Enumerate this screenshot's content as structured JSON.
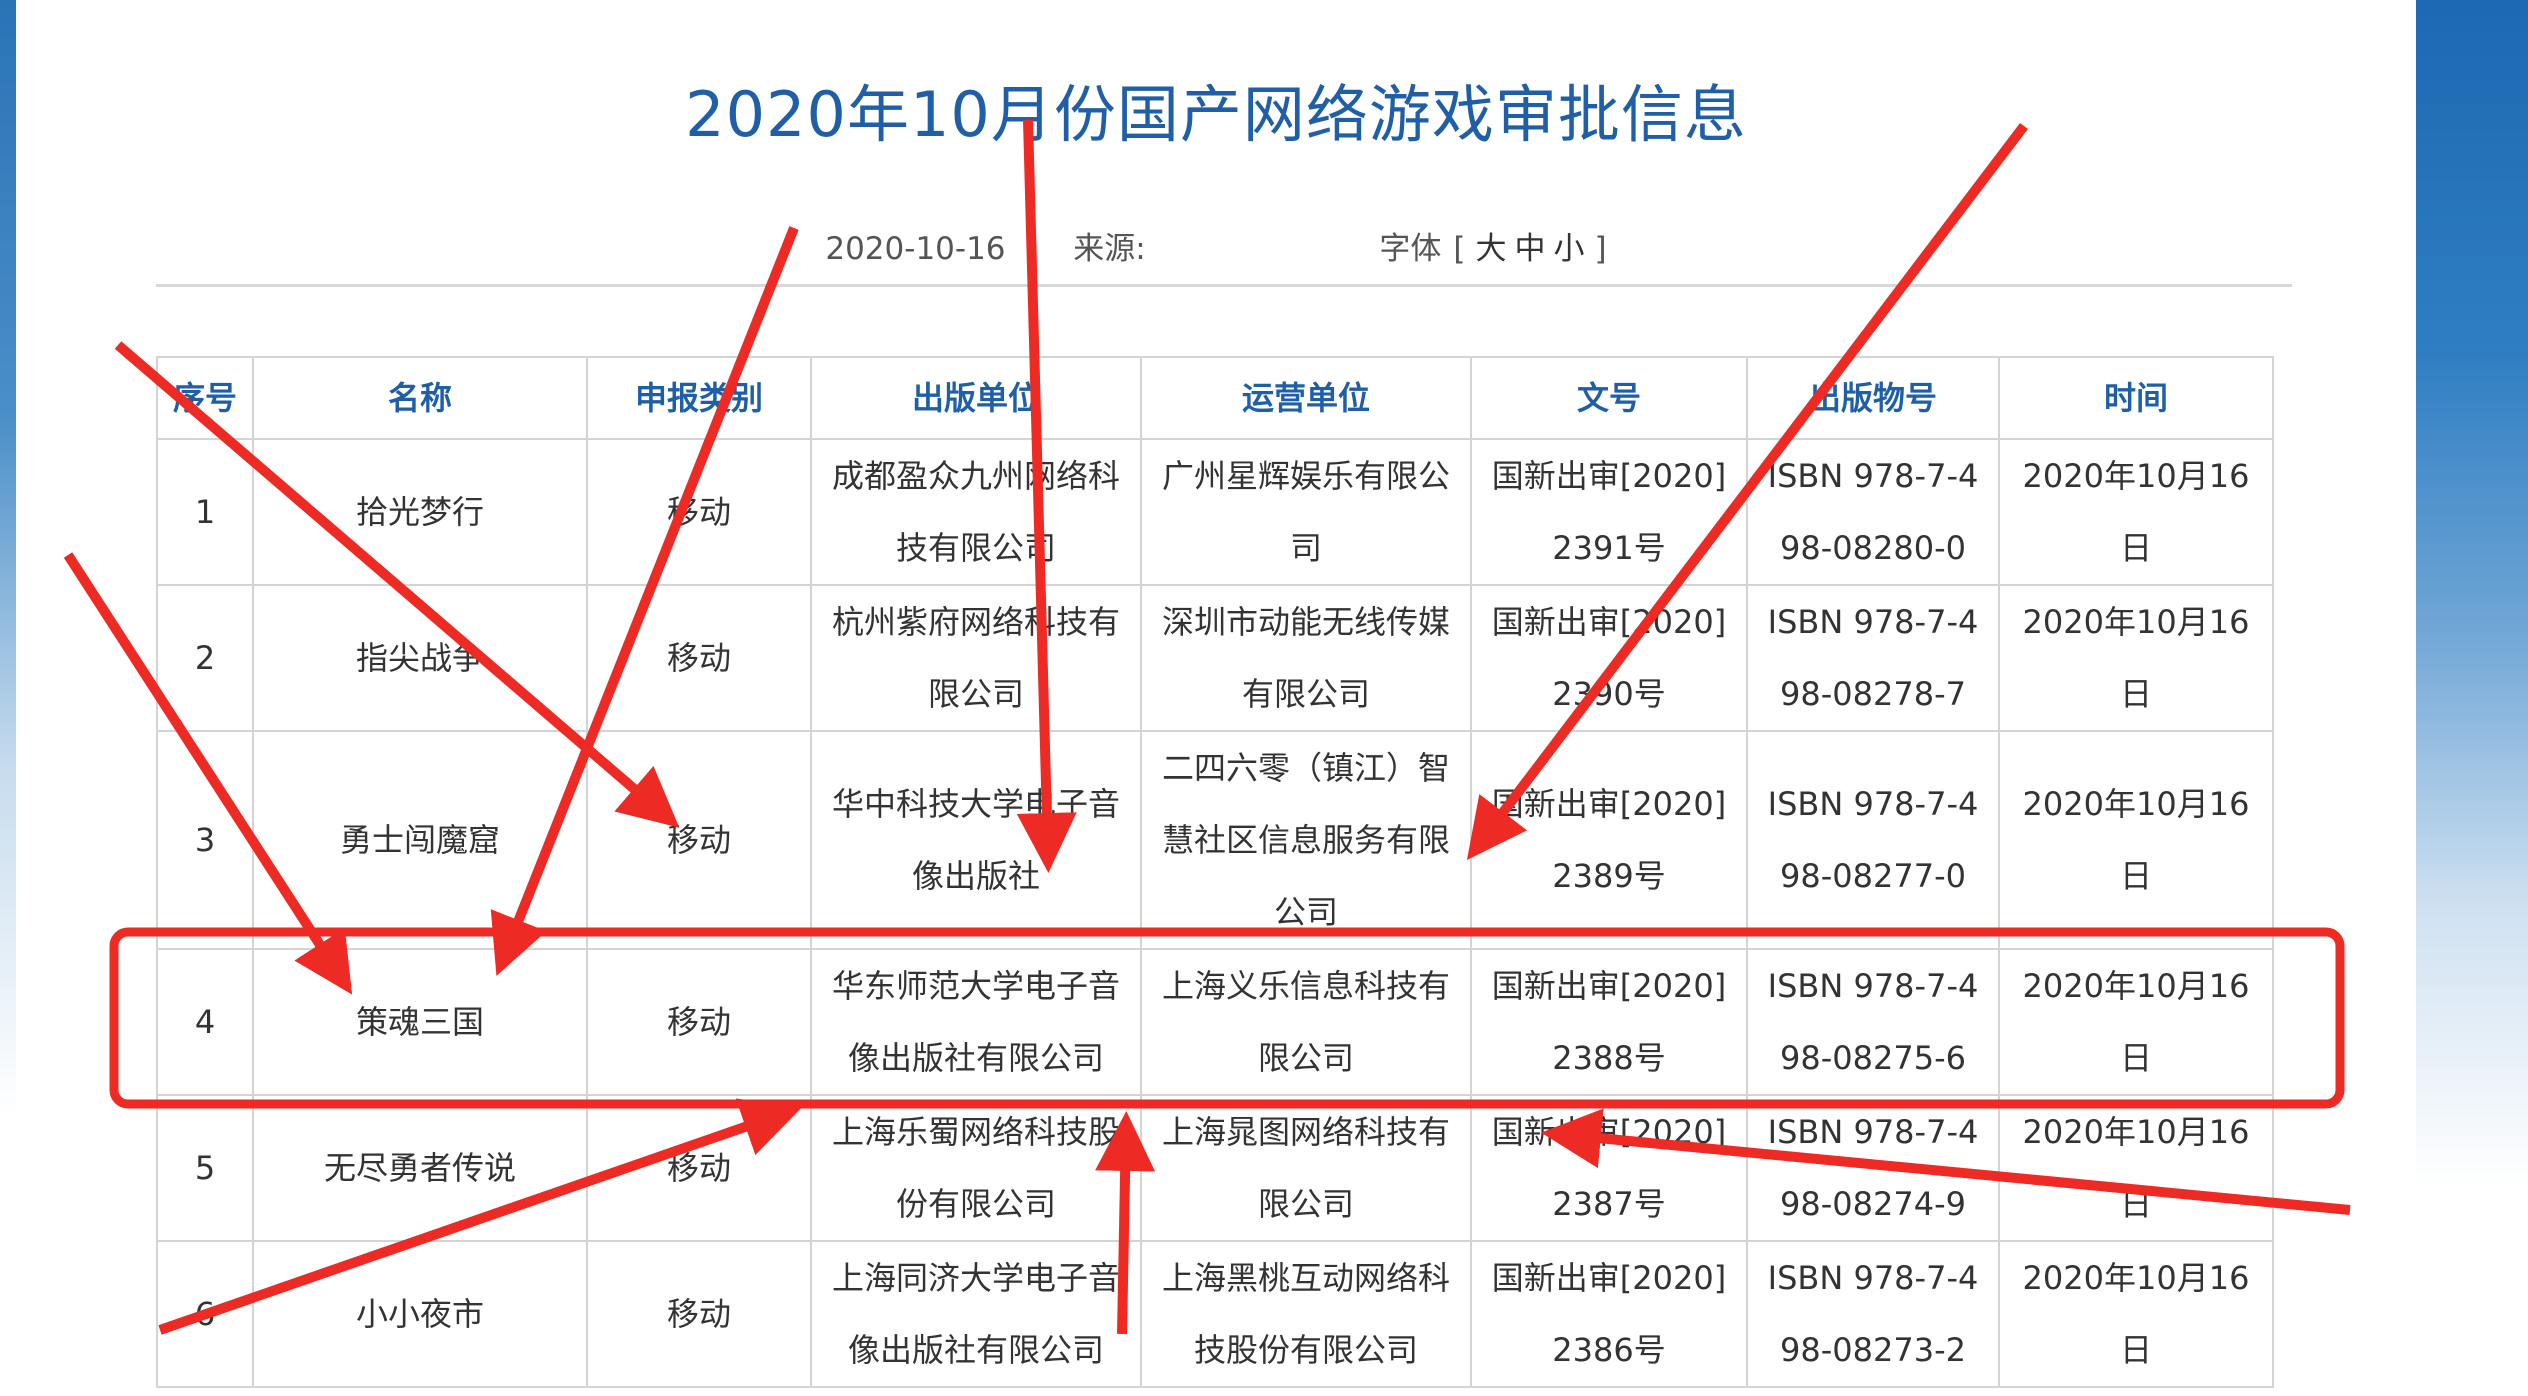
{
  "page": {
    "title": "2020年10月份国产网络游戏审批信息",
    "date": "2020-10-16",
    "source_label": "来源:",
    "font_label": "字体",
    "bracket_open": "[",
    "bracket_close": "]",
    "font_sizes": [
      "大",
      "中",
      "小"
    ]
  },
  "table": {
    "headers": [
      "序号",
      "名称",
      "申报类别",
      "出版单位",
      "运营单位",
      "文号",
      "出版物号",
      "时间"
    ],
    "rows": [
      [
        "1",
        "拾光梦行",
        "移动",
        "成都盈众九州网络科技有限公司",
        "广州星辉娱乐有限公司",
        "国新出审[2020]2391号",
        "ISBN 978-7-498-08280-0",
        "2020年10月16日"
      ],
      [
        "2",
        "指尖战争",
        "移动",
        "杭州紫府网络科技有限公司",
        "深圳市动能无线传媒有限公司",
        "国新出审[2020]2390号",
        "ISBN 978-7-498-08278-7",
        "2020年10月16日"
      ],
      [
        "3",
        "勇士闯魔窟",
        "移动",
        "华中科技大学电子音像出版社",
        "二四六零（镇江）智慧社区信息服务有限公司",
        "国新出审[2020]2389号",
        "ISBN 978-7-498-08277-0",
        "2020年10月16日"
      ],
      [
        "4",
        "策魂三国",
        "移动",
        "华东师范大学电子音像出版社有限公司",
        "上海义乐信息科技有限公司",
        "国新出审[2020]2388号",
        "ISBN 978-7-498-08275-6",
        "2020年10月16日"
      ],
      [
        "5",
        "无尽勇者传说",
        "移动",
        "上海乐蜀网络科技股份有限公司",
        "上海晁图网络科技有限公司",
        "国新出审[2020]2387号",
        "ISBN 978-7-498-08274-9",
        "2020年10月16日"
      ],
      [
        "6",
        "小小夜市",
        "移动",
        "上海同济大学电子音像出版社有限公司",
        "上海黑桃互动网络科技股份有限公司",
        "国新出审[2020]2386号",
        "ISBN 978-7-498-08273-2",
        "2020年10月16日"
      ]
    ]
  },
  "colors": {
    "title": "#1f5fa8",
    "header_text": "#1f5fa8",
    "annotation_red": "#ee2a24",
    "frame_blue": "#1d69b2"
  }
}
